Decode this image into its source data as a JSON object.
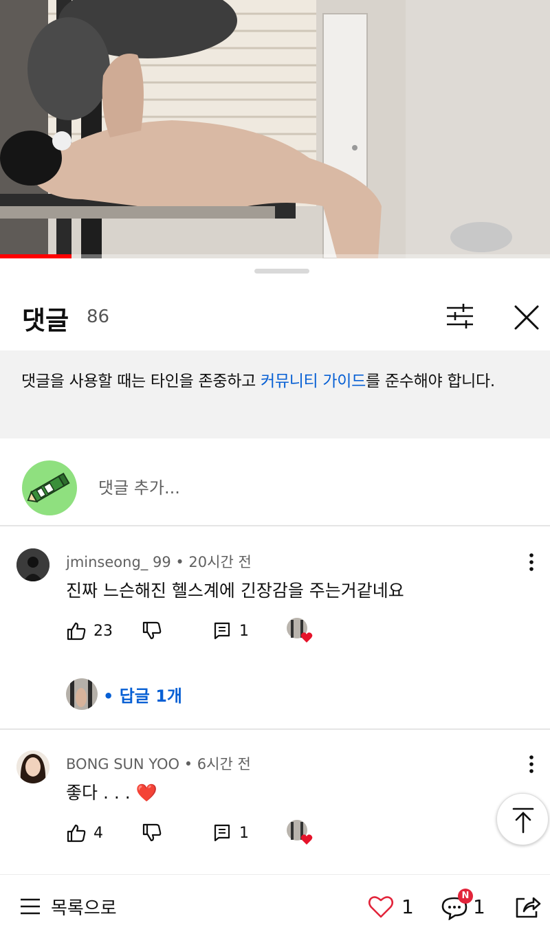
{
  "video": {
    "progress_fraction": 0.13,
    "accent_color": "#ff0000"
  },
  "comments_panel": {
    "title": "댓글",
    "count": "86",
    "filter_icon": "sliders-icon",
    "close_icon": "close-icon",
    "guide": {
      "text_before": "댓글을 사용할 때는 타인을 존중하고 ",
      "link": "커뮤니티 가이드",
      "text_after": "를 준수해야 합니다."
    },
    "add_comment_placeholder": "댓글 추가...",
    "comments": [
      {
        "author": "jminseong_ 99",
        "time": "• 20시간 전",
        "text": "진짜 느슨해진 헬스계에 긴장감을 주는거같네요",
        "likes": "23",
        "reply_count": "1",
        "replies_label": "• 답글 1개"
      },
      {
        "author": "BONG SUN YOO",
        "time": "• 6시간 전",
        "text": "좋다 . . . ❤️",
        "likes": "4",
        "reply_count": "1"
      }
    ]
  },
  "bottom_bar": {
    "menu_label": "목록으로",
    "like_count": "1",
    "comment_count": "1",
    "new_badge": "N",
    "share_icon": "share-icon"
  }
}
